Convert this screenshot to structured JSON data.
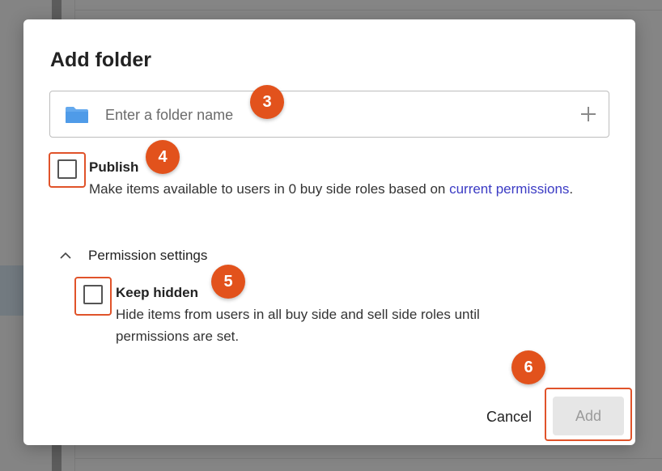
{
  "dialog": {
    "title": "Add folder",
    "folder_input": {
      "placeholder": "Enter a folder name",
      "value": ""
    },
    "publish": {
      "label": "Publish",
      "checked": false,
      "description_pre": "Make items available to users in 0 buy side roles based on ",
      "description_link": "current permissions",
      "description_post": "."
    },
    "permission_settings": {
      "label": "Permission settings",
      "expanded": true,
      "keep_hidden": {
        "label": "Keep hidden",
        "checked": false,
        "description": "Hide items from users in all buy side and sell side roles until permissions are set."
      }
    },
    "actions": {
      "cancel_label": "Cancel",
      "add_label": "Add",
      "add_disabled": true
    }
  },
  "annotations": {
    "badge_3": "3",
    "badge_4": "4",
    "badge_5": "5",
    "badge_6": "6",
    "color": "#e2521c"
  },
  "icons": {
    "folder": "folder-icon",
    "plus": "plus-icon",
    "chevron": "chevron-up-icon"
  },
  "colors": {
    "folder_icon": "#64a9ee",
    "link": "#3b3bc4",
    "add_button_disabled_bg": "#e6e6e6"
  }
}
